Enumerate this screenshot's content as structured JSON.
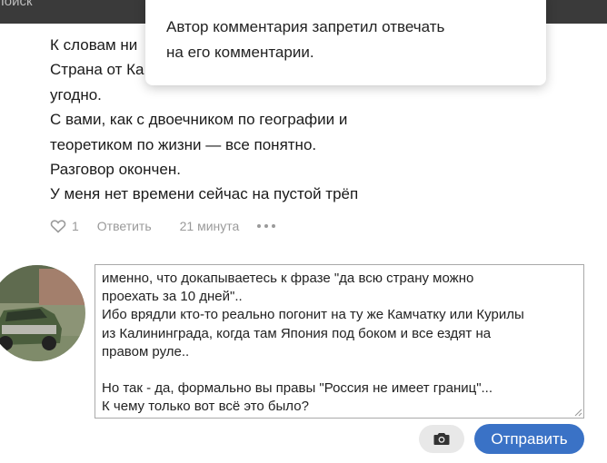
{
  "topbar": {
    "search_label": "Поиск"
  },
  "comment": {
    "lines": [
      "К словам ни",
      "Страна от Ка",
      "угодно.",
      "С вами, как с двоечником по географии и",
      "теоретиком по жизни — все понятно.",
      "Разговор окончен.",
      "У меня нет времени сейчас на пустой трёп"
    ],
    "likes": "1",
    "reply_label": "Ответить",
    "time": "21 минута"
  },
  "tooltip": {
    "lines": [
      "Автор комментария запретил отвечать",
      "на его комментарии."
    ]
  },
  "reply_box": {
    "lines": [
      "именно, что докапываетесь к фразе \"да всю страну можно",
      "проехать за 10 дней\"..",
      "Ибо врядли кто-то реально погонит на ту же Камчатку или Курилы",
      "из Калининграда, когда там Япония под боком и все ездят на",
      "правом руле..",
      "",
      "Но так - да, формально вы правы \"Россия не имеет границ\"...",
      "К чему только вот всё это было?"
    ]
  },
  "buttons": {
    "send_label": "Отправить"
  },
  "icons": {
    "like": "heart-icon",
    "more": "more-dots-icon",
    "camera": "camera-icon"
  },
  "colors": {
    "send_button": "#3a72c6",
    "camera_button_bg": "#e8e8e8",
    "muted_text": "#9a9a9a"
  }
}
